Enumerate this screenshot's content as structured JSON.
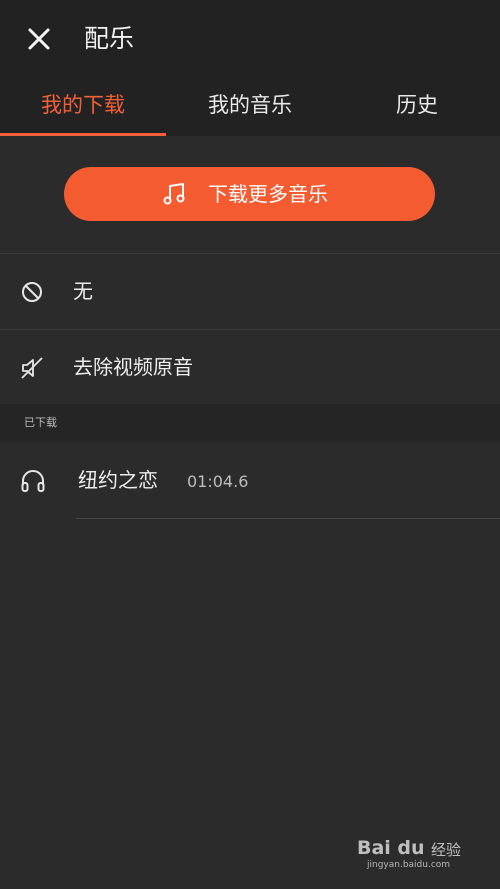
{
  "header": {
    "title": "配乐"
  },
  "tabs": [
    {
      "label": "我的下载",
      "active": true
    },
    {
      "label": "我的音乐",
      "active": false
    },
    {
      "label": "历史",
      "active": false
    }
  ],
  "download_more": {
    "label": "下载更多音乐",
    "icon": "music-note-icon"
  },
  "options": [
    {
      "label": "无",
      "icon": "no-symbol-icon"
    },
    {
      "label": "去除视频原音",
      "icon": "mute-icon"
    }
  ],
  "downloaded": {
    "section_title": "已下载",
    "tracks": [
      {
        "name": "纽约之恋",
        "duration": "01:04.6",
        "icon": "headphones-icon"
      }
    ]
  },
  "watermark": {
    "brand": "Bai du",
    "suffix": "经验",
    "site": "jingyan.baidu.com"
  },
  "colors": {
    "accent": "#f55b31",
    "background": "#2b2b2b",
    "header": "#222222"
  }
}
